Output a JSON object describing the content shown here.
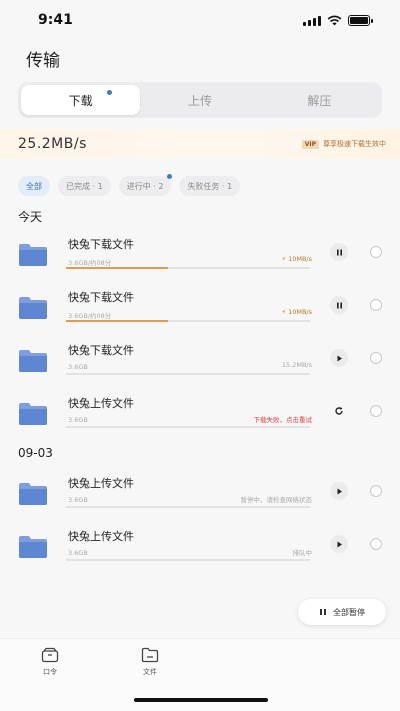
{
  "status_bar": {
    "time": "9:41",
    "signal_icon": "signal-icon",
    "wifi_icon": "wifi-icon",
    "battery_icon": "battery-icon"
  },
  "page": {
    "title": "传输"
  },
  "tabs": [
    {
      "label": "下载",
      "active": true,
      "has_dot": true
    },
    {
      "label": "上传",
      "active": false,
      "has_dot": false
    },
    {
      "label": "解压",
      "active": false,
      "has_dot": false
    }
  ],
  "speed_bar": {
    "speed": "25.2MB/s",
    "vip_badge": "VIP",
    "vip_text": "尊享极速下载生效中"
  },
  "filters": [
    {
      "label": "全部",
      "active": true,
      "has_dot": false
    },
    {
      "label": "已完成 · 1",
      "active": false,
      "has_dot": false
    },
    {
      "label": "进行中 · 2",
      "active": false,
      "has_dot": true
    },
    {
      "label": "失败任务 · 1",
      "active": false,
      "has_dot": false
    }
  ],
  "sections": {
    "today": "今天",
    "earlier": "09-03"
  },
  "files": [
    {
      "name": "快兔下载文件",
      "size": "3.6GB/约08分",
      "status": "10MB/s",
      "status_type": "speed",
      "progress": 0.42,
      "action_icon": "pause-icon"
    },
    {
      "name": "快兔下载文件",
      "size": "3.6GB/约08分",
      "status": "10MB/s",
      "status_type": "speed",
      "progress": 0.42,
      "action_icon": "pause-icon"
    },
    {
      "name": "快兔下载文件",
      "size": "3.6GB",
      "status": "15.2MB/s",
      "status_type": "normal",
      "progress": 0,
      "action_icon": "play-icon"
    },
    {
      "name": "快兔上传文件",
      "size": "3.6GB",
      "status": "下载失败，点击重试",
      "status_type": "error",
      "progress": 0,
      "action_icon": "retry-icon"
    },
    {
      "name": "快兔上传文件",
      "size": "3.6GB",
      "status": "暂停中，请检查网络状态",
      "status_type": "normal",
      "progress": 0,
      "action_icon": "play-icon"
    },
    {
      "name": "快兔上传文件",
      "size": "3.6GB",
      "status": "排队中",
      "status_type": "normal",
      "progress": 0,
      "action_icon": "play-icon"
    }
  ],
  "pause_all": {
    "label": "全部暂停",
    "icon": "pause-icon"
  },
  "bottom_nav": [
    {
      "label": "口令",
      "icon": "box-icon"
    },
    {
      "label": "文件",
      "icon": "folder-outline-icon"
    }
  ],
  "colors": {
    "accent": "#3a7bd5",
    "progress": "#e39a4a",
    "error": "#e0433b",
    "vip": "#b07030"
  }
}
